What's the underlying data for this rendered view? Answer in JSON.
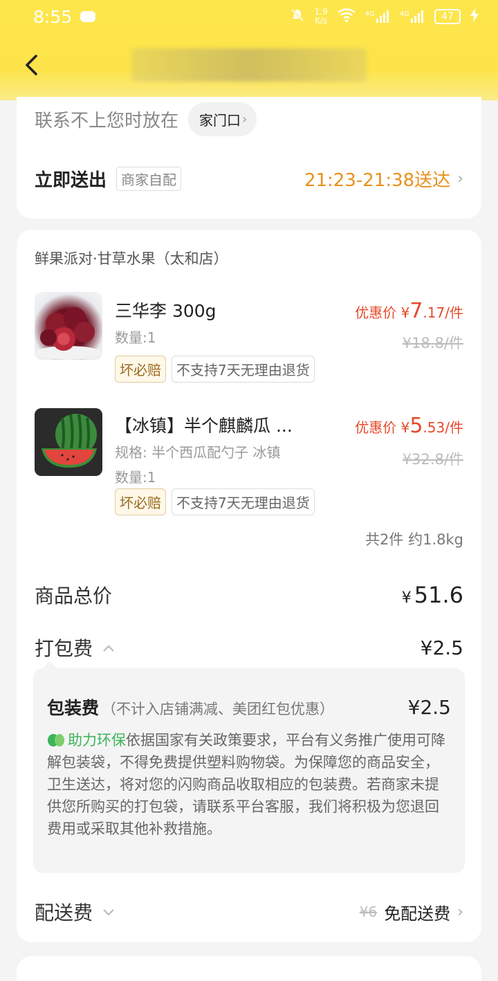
{
  "status": {
    "time": "8:55",
    "net_speed_top": "1.9",
    "net_speed_unit": "K/s",
    "battery": "47",
    "signal1": "4G",
    "signal2": "4G"
  },
  "delivery": {
    "contact_label": "联系不上您时放在",
    "contact_option": "家门口",
    "send_label": "立即送出",
    "send_tag": "商家自配",
    "arrival_time": "21:23-21:38送达"
  },
  "order": {
    "store": "鲜果派对·甘草水果（太和店）",
    "items": [
      {
        "name": "三华李 300g",
        "qty": "数量:1",
        "price_prefix": "优惠价 ¥",
        "price_int": "7",
        "price_dec": ".17/件",
        "old_price": "¥18.8/件",
        "badge1": "坏必赔",
        "badge2": "不支持7天无理由退货"
      },
      {
        "name": "【冰镇】半个麒麟瓜 ...",
        "spec": "规格: 半个西瓜配勺子 冰镇",
        "qty": "数量:1",
        "price_prefix": "优惠价 ¥",
        "price_int": "5",
        "price_dec": ".53/件",
        "old_price": "¥32.8/件",
        "badge1": "坏必赔",
        "badge2": "不支持7天无理由退货"
      }
    ],
    "summary": "共2件 约1.8kg",
    "total_label": "商品总价",
    "total_yen": "¥",
    "total_value": "51.6",
    "pack_label": "打包费",
    "pack_value": "¥2.5",
    "pack_detail": {
      "title": "包装费",
      "note": "（不计入店铺满减、美团红包优惠）",
      "amount": "¥2.5",
      "eco_label": "助力环保",
      "text": "依据国家有关政策要求，平台有义务推广使用可降解包装袋，不得免费提供塑料购物袋。为保障您的商品安全，卫生送达，将对您的闪购商品收取相应的包装费。若商家未提供您所购买的打包袋，请联系平台客服，我们将积极为您退回费用或采取其他补救措施。"
    },
    "shipping_label": "配送费",
    "shipping_old": "¥6",
    "shipping_free": "免配送费"
  },
  "colors": {
    "brand_yellow": "#fde64c",
    "accent_orange": "#e8911c",
    "price_red": "#e54a2c",
    "eco_green": "#3cb45a"
  }
}
